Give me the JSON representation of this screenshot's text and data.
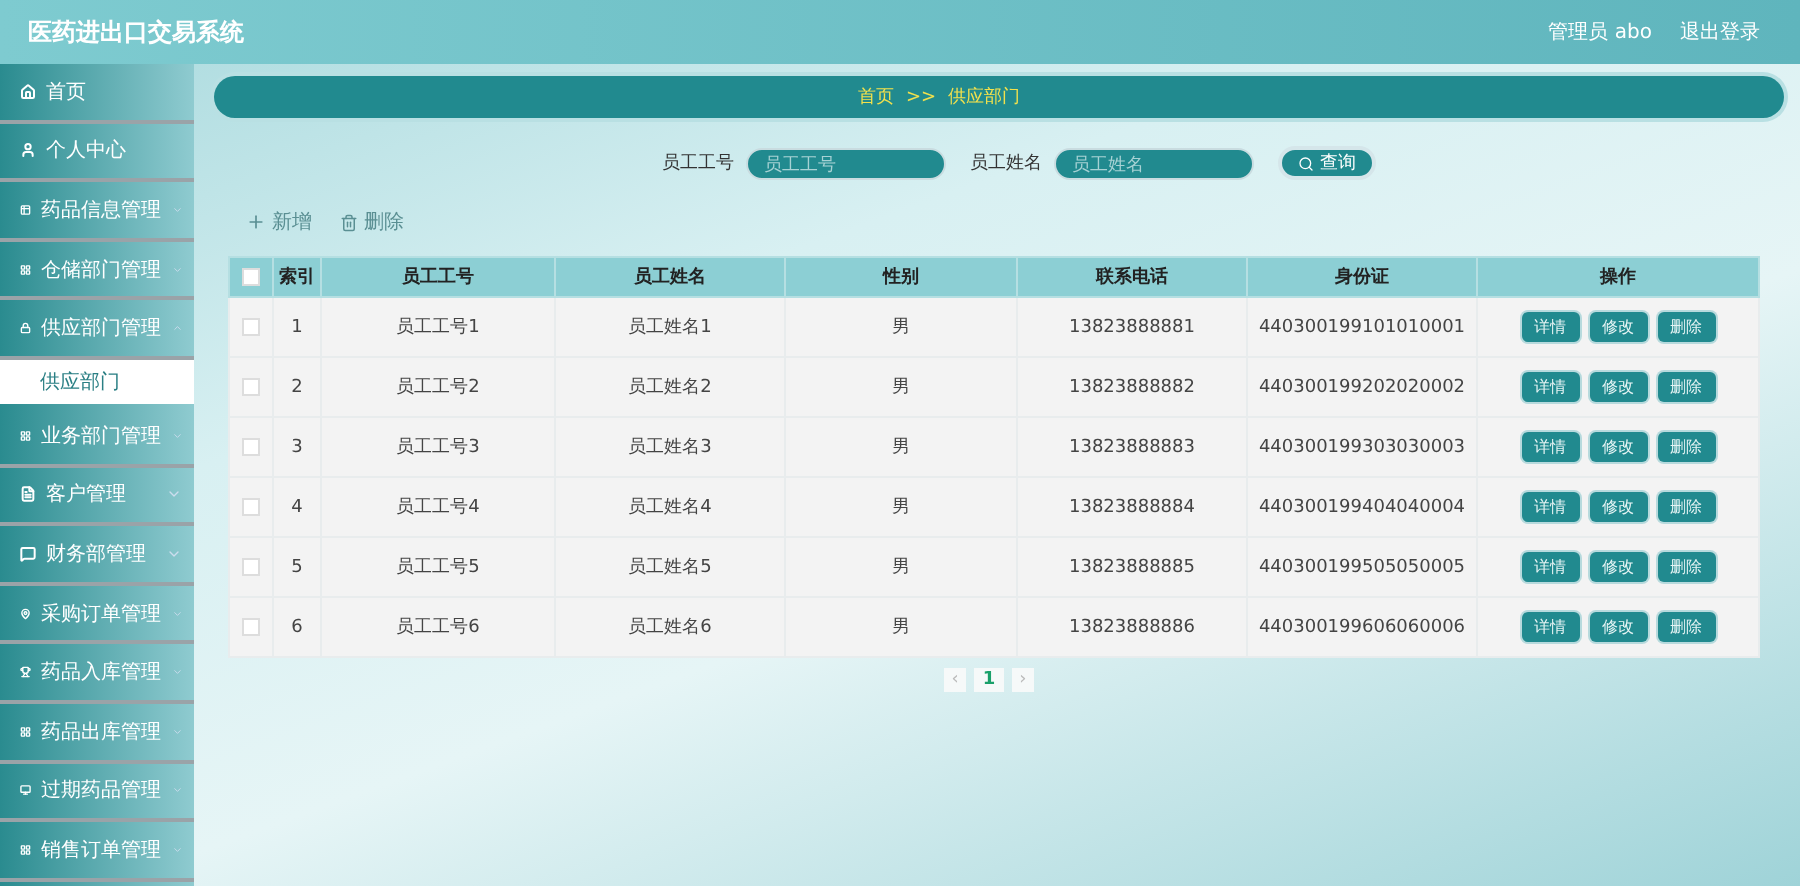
{
  "header": {
    "title": "医药进出口交易系统",
    "user": "管理员 abo",
    "logout": "退出登录"
  },
  "sidebar": {
    "items": [
      {
        "label": "首页",
        "kind": "link"
      },
      {
        "label": "个人中心",
        "kind": "link"
      },
      {
        "label": "药品信息管理",
        "kind": "group",
        "expanded": false
      },
      {
        "label": "仓储部门管理",
        "kind": "group",
        "expanded": false
      },
      {
        "label": "供应部门管理",
        "kind": "group",
        "expanded": true,
        "children": [
          {
            "label": "供应部门",
            "selected": true
          }
        ]
      },
      {
        "label": "业务部门管理",
        "kind": "group",
        "expanded": false
      },
      {
        "label": "客户管理",
        "kind": "group",
        "expanded": false
      },
      {
        "label": "财务部管理",
        "kind": "group",
        "expanded": false
      },
      {
        "label": "采购订单管理",
        "kind": "group",
        "expanded": false
      },
      {
        "label": "药品入库管理",
        "kind": "group",
        "expanded": false
      },
      {
        "label": "药品出库管理",
        "kind": "group",
        "expanded": false
      },
      {
        "label": "过期药品管理",
        "kind": "group",
        "expanded": false
      },
      {
        "label": "销售订单管理",
        "kind": "group",
        "expanded": false
      }
    ]
  },
  "breadcrumb": [
    "首页",
    ">>",
    "供应部门"
  ],
  "search": {
    "fields": [
      {
        "label": "员工工号",
        "placeholder": "员工工号"
      },
      {
        "label": "员工姓名",
        "placeholder": "员工姓名"
      }
    ],
    "button": "查询"
  },
  "actions": [
    {
      "kind": "add",
      "label": "新增"
    },
    {
      "kind": "delete",
      "label": "删除"
    }
  ],
  "table": {
    "all_checked": false,
    "columns": [
      "索引",
      "员工工号",
      "员工姓名",
      "性别",
      "联系电话",
      "身份证",
      "操作"
    ],
    "rows": [
      {
        "checked": false,
        "cells": [
          "1",
          "员工工号1",
          "员工姓名1",
          "男",
          "13823888881",
          "440300199101010001"
        ],
        "buttons": [
          "详情",
          "修改",
          "删除"
        ]
      },
      {
        "checked": false,
        "cells": [
          "2",
          "员工工号2",
          "员工姓名2",
          "男",
          "13823888882",
          "440300199202020002"
        ],
        "buttons": [
          "详情",
          "修改",
          "删除"
        ]
      },
      {
        "checked": false,
        "cells": [
          "3",
          "员工工号3",
          "员工姓名3",
          "男",
          "13823888883",
          "440300199303030003"
        ],
        "buttons": [
          "详情",
          "修改",
          "删除"
        ]
      },
      {
        "checked": false,
        "cells": [
          "4",
          "员工工号4",
          "员工姓名4",
          "男",
          "13823888884",
          "440300199404040004"
        ],
        "buttons": [
          "详情",
          "修改",
          "删除"
        ]
      },
      {
        "checked": false,
        "cells": [
          "5",
          "员工工号5",
          "员工姓名5",
          "男",
          "13823888885",
          "440300199505050005"
        ],
        "buttons": [
          "详情",
          "修改",
          "删除"
        ]
      },
      {
        "checked": false,
        "cells": [
          "6",
          "员工工号6",
          "员工姓名6",
          "男",
          "13823888886",
          "440300199606060006"
        ],
        "buttons": [
          "详情",
          "修改",
          "删除"
        ]
      }
    ]
  },
  "pagination": {
    "prev": "‹",
    "pages": [
      {
        "label": "1",
        "selected": true
      }
    ],
    "next": "›"
  }
}
